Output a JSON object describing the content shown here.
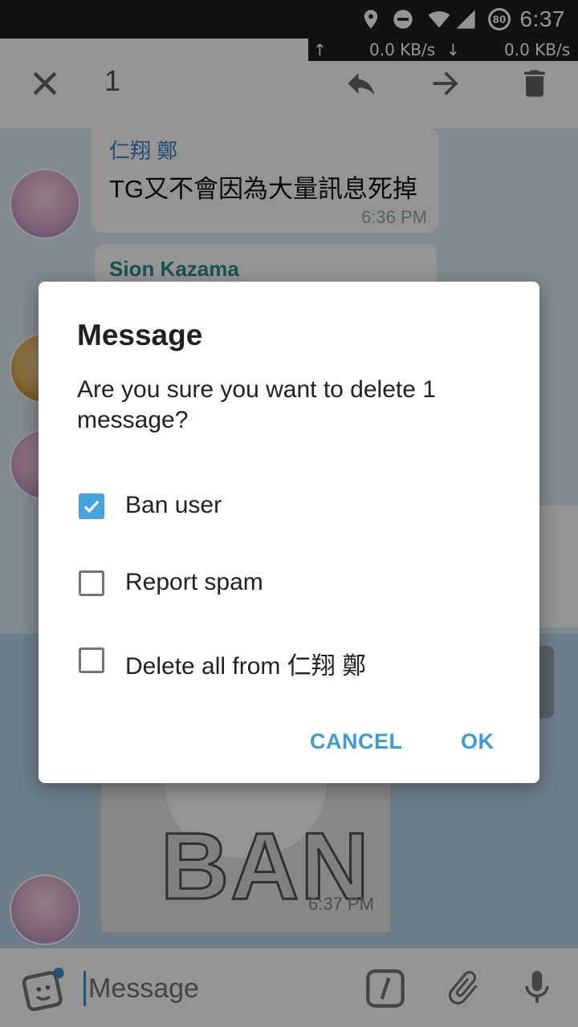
{
  "status_bar": {
    "time": "6:37",
    "battery_level": "80",
    "icons": [
      "location-icon",
      "do-not-disturb-icon",
      "wifi-icon",
      "cell-signal-icon",
      "battery-icon"
    ]
  },
  "net_speed": {
    "up": "0.0 KB/s",
    "down": "0.0 KB/s"
  },
  "action_bar": {
    "selected_count": "1",
    "icons": [
      "close-icon",
      "reply-icon",
      "forward-icon",
      "delete-icon"
    ]
  },
  "chat": {
    "messages": [
      {
        "sender": "仁翔 鄭",
        "text": "TG又不會因為大量訊息死掉",
        "time": "6:36 PM"
      },
      {
        "sender": "Sion Kazama",
        "text": "",
        "time": ""
      },
      {
        "sender": "",
        "sticker_text": "BAN",
        "time": "6:37 PM"
      }
    ]
  },
  "input": {
    "placeholder": "Message"
  },
  "dialog": {
    "title": "Message",
    "body": "Are you sure you want to delete 1 message?",
    "options": [
      {
        "label": "Ban user",
        "checked": true
      },
      {
        "label": "Report spam",
        "checked": false
      },
      {
        "label": "Delete all from 仁翔 鄭",
        "checked": false
      }
    ],
    "cancel_label": "CANCEL",
    "ok_label": "OK"
  },
  "colors": {
    "accent": "#44a4e0",
    "button_text": "#3d9bd3",
    "sender_blue": "#3a87c5",
    "sender_teal": "#2a8f86"
  }
}
